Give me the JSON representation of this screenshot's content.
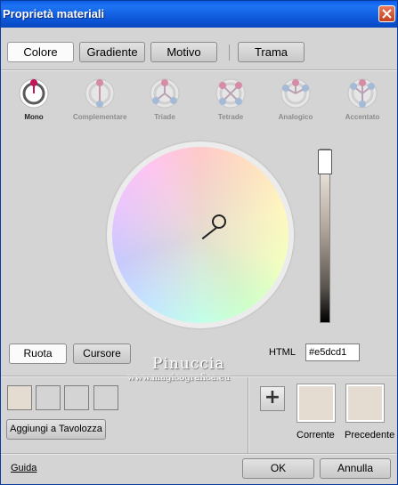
{
  "window": {
    "title": "Proprietà materiali"
  },
  "tabs": [
    {
      "label": "Colore",
      "active": true
    },
    {
      "label": "Gradiente",
      "active": false
    },
    {
      "label": "Motivo",
      "active": false
    },
    {
      "label": "Trama",
      "active": false
    }
  ],
  "harmonies": [
    {
      "label": "Mono",
      "icon": "mono-harmony-icon",
      "active": true
    },
    {
      "label": "Complementare",
      "icon": "complementary-harmony-icon",
      "active": false
    },
    {
      "label": "Triade",
      "icon": "triad-harmony-icon",
      "active": false
    },
    {
      "label": "Tetrade",
      "icon": "tetrad-harmony-icon",
      "active": false
    },
    {
      "label": "Analogico",
      "icon": "analogous-harmony-icon",
      "active": false
    },
    {
      "label": "Accentato",
      "icon": "accented-harmony-icon",
      "active": false
    }
  ],
  "view_toggle": {
    "wheel_label": "Ruota",
    "slider_label": "Cursore",
    "active": "Ruota"
  },
  "html_field": {
    "label": "HTML",
    "value": "#e5dcd1"
  },
  "watermark": {
    "line1": "Pinuccia",
    "line2": "www.magicografica.eu"
  },
  "palette": {
    "swatches": [
      "#e5dcd1",
      "#d4d4d4",
      "#d4d4d4",
      "#d4d4d4"
    ],
    "add_label": "Aggiungi a Tavolozza"
  },
  "colors": {
    "current": "#e5dcd1",
    "previous": "#e5dcd1",
    "current_label": "Corrente",
    "previous_label": "Precedente"
  },
  "footer": {
    "help_label": "Guida",
    "ok_label": "OK",
    "cancel_label": "Annulla"
  }
}
